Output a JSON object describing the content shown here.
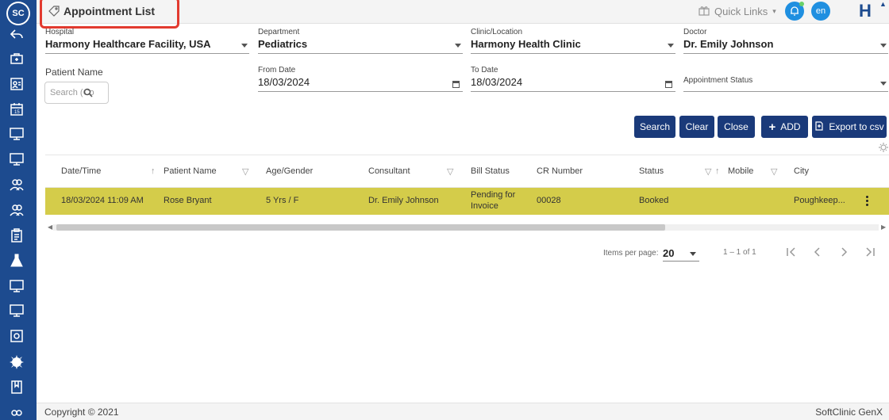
{
  "app": {
    "logo_text": "SC",
    "title": "Appointment List",
    "brand_letter": "H",
    "lang": "en",
    "quick_links": "Quick Links"
  },
  "filters": {
    "hospital": {
      "label": "Hospital",
      "value": "Harmony Healthcare Facility, USA"
    },
    "department": {
      "label": "Department",
      "value": "Pediatrics"
    },
    "clinic": {
      "label": "Clinic/Location",
      "value": "Harmony Health Clinic"
    },
    "doctor": {
      "label": "Doctor",
      "value": "Dr. Emily Johnson"
    },
    "patient_name": {
      "label": "Patient Name",
      "placeholder": "Search (Co"
    },
    "from_date": {
      "label": "From Date",
      "value": "18/03/2024"
    },
    "to_date": {
      "label": "To Date",
      "value": "18/03/2024"
    },
    "appointment_status": {
      "label": "Appointment Status",
      "value": ""
    }
  },
  "buttons": {
    "search": "Search",
    "clear": "Clear",
    "close": "Close",
    "add": "ADD",
    "export": "Export to csv"
  },
  "table": {
    "columns": [
      "Date/Time",
      "Patient Name",
      "Age/Gender",
      "Consultant",
      "Bill Status",
      "CR Number",
      "Status",
      "Mobile",
      "City"
    ],
    "rows": [
      {
        "datetime": "18/03/2024 11:09 AM",
        "patient": "Rose Bryant",
        "age_gender": "5 Yrs / F",
        "consultant": "Dr. Emily Johnson",
        "bill_status_1": "Pending for",
        "bill_status_2": "Invoice",
        "cr_number": "00028",
        "status": "Booked",
        "mobile": "",
        "city": "Poughkeep..."
      }
    ],
    "row_highlight": "#d4cc4a"
  },
  "paginator": {
    "items_per_page_label": "Items per page:",
    "items_per_page": "20",
    "range": "1 – 1 of 1"
  },
  "footer": {
    "copyright": "Copyright © 2021",
    "brand": "SoftClinic GenX"
  },
  "colors": {
    "sidebar": "#1d4b8f",
    "button": "#1a3a7a",
    "title_box": "#e23a2f",
    "accent": "#1f8fe0"
  },
  "sidebar_icons": [
    "back-arrow-icon",
    "briefcase-icon",
    "id-card-icon",
    "calendar-icon",
    "monitor-icon",
    "monitor-icon",
    "users-icon",
    "users-icon",
    "clipboard-icon",
    "flask-icon",
    "monitor-icon",
    "monitor-icon",
    "safe-icon",
    "gear-badge-icon",
    "book-icon",
    "more-icon"
  ]
}
